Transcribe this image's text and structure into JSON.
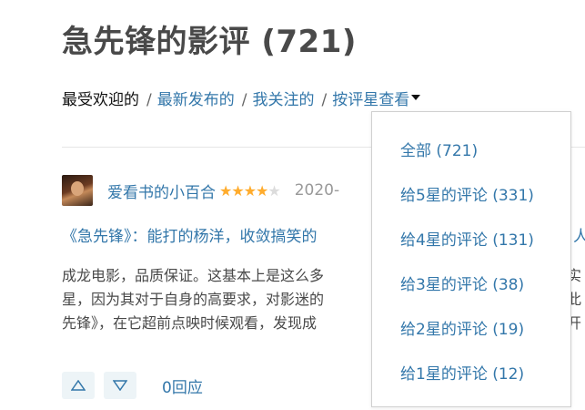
{
  "page": {
    "title": "急先锋的影评 (721)"
  },
  "sort": {
    "popular": "最受欢迎的",
    "newest": "最新发布的",
    "following": "我关注的",
    "by_rating": "按评星查看"
  },
  "review": {
    "author": "爱看书的小百合",
    "rating": 4,
    "rating_max": 5,
    "date": "2020-",
    "title": "《急先锋》：能打的杨洋，收敛搞笑的",
    "title_tail": "人",
    "body_lines": [
      "成龙电影，品质保证。这基本上是这么多",
      "星，因为其对于自身的高要求，对影迷的",
      "先锋》，在它超前点映时候观看，发现成"
    ],
    "body_tails": [
      "实",
      "此",
      "开"
    ],
    "reply_count": "0回应"
  },
  "rating_filter": {
    "options": [
      "全部 (721)",
      "给5星的评论 (331)",
      "给4星的评论 (131)",
      "给3星的评论 (38)",
      "给2星的评论 (19)",
      "给1星的评论 (12)"
    ]
  },
  "colors": {
    "link": "#3377aa",
    "star": "#ffac2d",
    "title": "#494949"
  }
}
